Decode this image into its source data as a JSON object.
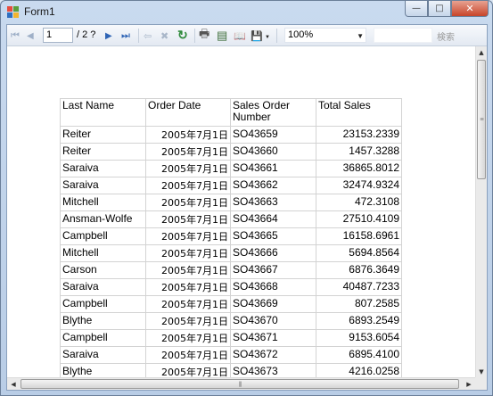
{
  "window": {
    "title": "Form1",
    "minimize_glyph": "—",
    "maximize_glyph": "□",
    "close_glyph": "✕"
  },
  "toolbar": {
    "current_page": "1",
    "page_total": "/ 2 ?",
    "zoom": "100%",
    "find_label": "検索",
    "find_value": ""
  },
  "icons": {
    "first": "⏮",
    "prev": "◀",
    "next": "▶",
    "last": "⏭",
    "back": "⇦",
    "stop": "✖",
    "refresh": "↻",
    "print": "🖶",
    "layout": "▤",
    "pagesetup": "📖",
    "export": "💾",
    "dropdown": "▼"
  },
  "table": {
    "headers": [
      "Last Name",
      "Order Date",
      "Sales Order Number",
      "Total Sales"
    ],
    "rows": [
      [
        "Reiter",
        "2005年7月1日",
        "SO43659",
        "23153.2339"
      ],
      [
        "Reiter",
        "2005年7月1日",
        "SO43660",
        "1457.3288"
      ],
      [
        "Saraiva",
        "2005年7月1日",
        "SO43661",
        "36865.8012"
      ],
      [
        "Saraiva",
        "2005年7月1日",
        "SO43662",
        "32474.9324"
      ],
      [
        "Mitchell",
        "2005年7月1日",
        "SO43663",
        "472.3108"
      ],
      [
        "Ansman-Wolfe",
        "2005年7月1日",
        "SO43664",
        "27510.4109"
      ],
      [
        "Campbell",
        "2005年7月1日",
        "SO43665",
        "16158.6961"
      ],
      [
        "Mitchell",
        "2005年7月1日",
        "SO43666",
        "5694.8564"
      ],
      [
        "Carson",
        "2005年7月1日",
        "SO43667",
        "6876.3649"
      ],
      [
        "Saraiva",
        "2005年7月1日",
        "SO43668",
        "40487.7233"
      ],
      [
        "Campbell",
        "2005年7月1日",
        "SO43669",
        "807.2585"
      ],
      [
        "Blythe",
        "2005年7月1日",
        "SO43670",
        "6893.2549"
      ],
      [
        "Campbell",
        "2005年7月1日",
        "SO43671",
        "9153.6054"
      ],
      [
        "Saraiva",
        "2005年7月1日",
        "SO43672",
        "6895.4100"
      ],
      [
        "Blythe",
        "2005年7月1日",
        "SO43673",
        "4216.0258"
      ]
    ]
  },
  "scroll": {
    "up": "▲",
    "down": "▼",
    "left": "◀",
    "right": "▶",
    "grip_h": "|||",
    "grip_v": "≡"
  },
  "colors": {
    "accent": "#3c6fb6",
    "close_button": "#c7452a"
  }
}
